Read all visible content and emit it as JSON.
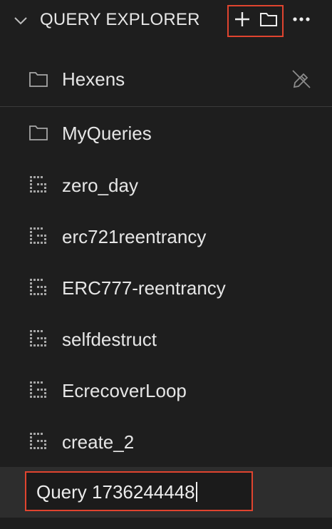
{
  "header": {
    "title": "QUERY EXPLORER",
    "actions": {
      "new_query_icon": "plus-icon",
      "new_folder_icon": "folder-icon",
      "more_icon": "more-icon"
    }
  },
  "items": [
    {
      "type": "folder",
      "label": "Hexens",
      "icon": "folder-icon",
      "hover_action": "clear-icon"
    },
    {
      "type": "folder",
      "label": "MyQueries",
      "icon": "folder-icon"
    },
    {
      "type": "query",
      "label": "zero_day",
      "icon": "query-file-icon"
    },
    {
      "type": "query",
      "label": "erc721reentrancy",
      "icon": "query-file-icon"
    },
    {
      "type": "query",
      "label": "ERC777-reentrancy",
      "icon": "query-file-icon"
    },
    {
      "type": "query",
      "label": "selfdestruct",
      "icon": "query-file-icon"
    },
    {
      "type": "query",
      "label": "EcrecoverLoop",
      "icon": "query-file-icon"
    },
    {
      "type": "query",
      "label": "create_2",
      "icon": "query-file-icon"
    }
  ],
  "new_query_input": {
    "value": "Query 1736244448"
  },
  "colors": {
    "background": "#1e1e1e",
    "highlight_row": "#2d2d2d",
    "annotation_box": "#e0442f",
    "text": "#e6e6e6",
    "icon": "#9a9a9a"
  }
}
